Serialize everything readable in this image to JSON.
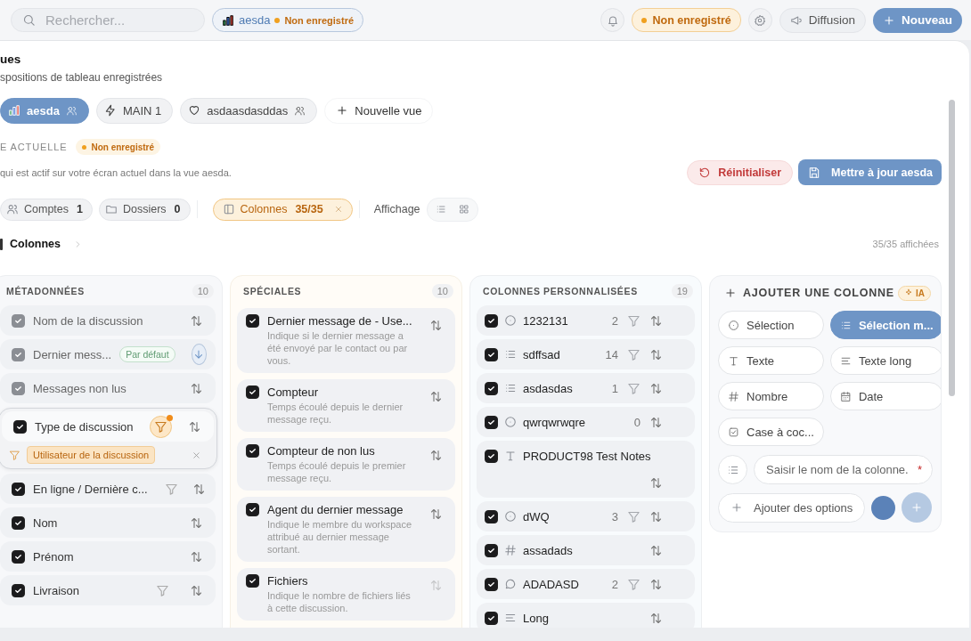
{
  "topbar": {
    "search": {
      "placeholder": "Rechercher..."
    },
    "view_chip": {
      "label": "aesda",
      "status": "Non enregistré"
    },
    "status": "Non enregistré",
    "buttons": [
      {
        "label": "Diffusion",
        "kind": "secondary"
      },
      {
        "label": "Nouveau",
        "kind": "primary"
      }
    ]
  },
  "header": {
    "title": "ues",
    "subtitle": "spositions de tableau enregistrées"
  },
  "views": [
    {
      "label": "aesda",
      "shared": true,
      "selected": true
    },
    {
      "label": "MAIN 1",
      "shared": false,
      "selected": false
    },
    {
      "label": "asdaasdasddas",
      "shared": true,
      "selected": false
    }
  ],
  "new_view": "Nouvelle vue",
  "current": {
    "label": "E ACTUELLE",
    "status": "Non enregistré",
    "description": "qui est actif sur votre écran actuel dans la vue aesda.",
    "reset": "Réinitialiser",
    "update": "Mettre à jour aesda"
  },
  "filters": [
    {
      "label": "Comptes",
      "count": "1",
      "selected": false
    },
    {
      "label": "Dossiers",
      "count": "0",
      "selected": false
    },
    {
      "label": "Colonnes",
      "count": "35/35",
      "selected": true
    }
  ],
  "display": {
    "label": "Affichage",
    "modes": [
      {
        "kind": "list"
      },
      {
        "kind": "grid"
      }
    ]
  },
  "breadcrumb": "Colonnes",
  "shown": "35/35 affichées",
  "groups": [
    {
      "kind": "meta",
      "title": "MÉTADONNÉES",
      "count": "10",
      "items": [
        {
          "label": "Nom de la discussion",
          "checked": true,
          "disabled": true,
          "filterable": false,
          "filtered": false,
          "sorted_desc": false
        },
        {
          "label": "Dernier mess...",
          "checked": true,
          "disabled": true,
          "badge": "Par défaut",
          "filterable": false,
          "filtered": false,
          "sorted_desc": true
        },
        {
          "label": "Messages non lus",
          "checked": true,
          "disabled": true,
          "filterable": false,
          "filtered": false,
          "sorted_desc": false
        },
        {
          "label": "Type de discussion",
          "checked": true,
          "disabled": false,
          "filterable": true,
          "filtered": true,
          "sorted_desc": false,
          "filter_value": "Utilisateur de la discussion"
        },
        {
          "label": "En ligne / Dernière c...",
          "checked": true,
          "disabled": false,
          "filterable": true,
          "filtered": false,
          "sorted_desc": false
        },
        {
          "label": "Nom",
          "checked": true,
          "disabled": false,
          "filterable": false,
          "filtered": false,
          "sorted_desc": false
        },
        {
          "label": "Prénom",
          "checked": true,
          "disabled": false,
          "filterable": false,
          "filtered": false,
          "sorted_desc": false
        },
        {
          "label": "Livraison",
          "checked": true,
          "disabled": false,
          "filterable": true,
          "filtered": false,
          "sorted_desc": false
        }
      ]
    },
    {
      "kind": "special",
      "title": "SPÉCIALES",
      "count": "10",
      "items": [
        {
          "label": "Dernier message de - Use...",
          "description": "Indique si le dernier message a été envoyé par le contact ou par vous.",
          "checked": true,
          "sortable": true
        },
        {
          "label": "Compteur",
          "description": "Temps écoulé depuis le dernier message reçu.",
          "checked": true,
          "sortable": true
        },
        {
          "label": "Compteur de non lus",
          "description": "Temps écoulé depuis le premier message reçu.",
          "checked": true,
          "sortable": true
        },
        {
          "label": "Agent du dernier message",
          "description": "Indique le membre du workspace attribué au dernier message sortant.",
          "checked": true,
          "sortable": true
        },
        {
          "label": "Fichiers",
          "description": "Indique le nombre de fichiers liés à cette discussion.",
          "checked": true,
          "sortable": false
        }
      ]
    },
    {
      "kind": "custom",
      "title": "COLONNES PERSONNALISÉES",
      "count": "19",
      "items": [
        {
          "kind": "select",
          "label": "1232131",
          "count": "2",
          "filterable": true,
          "checked": true
        },
        {
          "kind": "multiselect",
          "label": "sdffsad",
          "count": "14",
          "filterable": true,
          "checked": true
        },
        {
          "kind": "multiselect",
          "label": "asdasdas",
          "count": "1",
          "filterable": true,
          "checked": true
        },
        {
          "kind": "select",
          "label": "qwrqwrwqre",
          "count": "0",
          "filterable": false,
          "checked": true
        },
        {
          "kind": "text",
          "label": "PRODUCT98 Test Notes",
          "filterable": false,
          "checked": true
        },
        {
          "kind": "select",
          "label": "dWQ",
          "count": "3",
          "filterable": true,
          "checked": true
        },
        {
          "kind": "number",
          "label": "assadads",
          "filterable": false,
          "checked": true
        },
        {
          "kind": "comment",
          "label": "ADADASD",
          "count": "2",
          "filterable": true,
          "checked": true
        },
        {
          "kind": "longtext",
          "label": "Long",
          "filterable": false,
          "checked": true
        }
      ]
    }
  ],
  "add_column": {
    "title": "AJOUTER UNE COLONNE",
    "ai_badge": "IA",
    "types": [
      {
        "kind": "select",
        "label": "Sélection",
        "selected": false
      },
      {
        "kind": "multiselect",
        "label": "Sélection m...",
        "selected": true
      },
      {
        "kind": "text",
        "label": "Texte",
        "selected": false
      },
      {
        "kind": "longtext",
        "label": "Texte long",
        "selected": false
      },
      {
        "kind": "number",
        "label": "Nombre",
        "selected": false
      },
      {
        "kind": "date",
        "label": "Date",
        "selected": false
      },
      {
        "kind": "checkbox",
        "label": "Case à coc...",
        "selected": false
      }
    ],
    "name_field": {
      "placeholder": "Saisir le nom de la colonne.",
      "required_mark": "*"
    },
    "add_options": "Ajouter des options",
    "color": "#5b82b8",
    "submit": {
      "disabled": true
    }
  }
}
